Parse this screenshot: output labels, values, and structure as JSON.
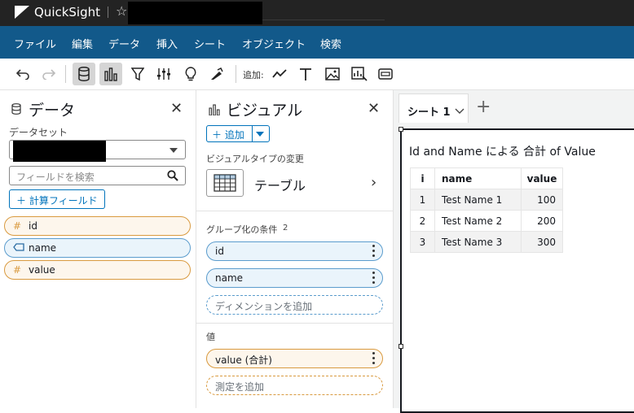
{
  "app": {
    "name": "QuickSight"
  },
  "menu": [
    "ファイル",
    "編集",
    "データ",
    "挿入",
    "シート",
    "オブジェクト",
    "検索"
  ],
  "toolbar": {
    "add_label": "追加:"
  },
  "data_panel": {
    "title": "データ",
    "dataset_label": "データセット",
    "search_placeholder": "フィールドを検索",
    "calc_field_label": "＋ 計算フィールド",
    "fields": [
      {
        "name": "id",
        "kind": "measure-number",
        "icon": "#"
      },
      {
        "name": "name",
        "kind": "dimension-text",
        "icon": "tag-icon"
      },
      {
        "name": "value",
        "kind": "measure-number",
        "icon": "#"
      }
    ]
  },
  "visual_panel": {
    "title": "ビジュアル",
    "add_label": "＋ 追加",
    "change_type_label": "ビジュアルタイプの変更",
    "type_name": "テーブル",
    "group_by_label": "グループ化の条件",
    "group_by_count": "2",
    "group_by_fields": [
      "id",
      "name"
    ],
    "add_dimension": "ディメンションを追加",
    "value_label": "値",
    "value_fields": [
      "value (合計)"
    ],
    "add_measure": "測定を追加"
  },
  "sheet": {
    "tab_label": "シート 1",
    "visual_title": "Id and Name による 合計 of Value",
    "table": {
      "headers": [
        "i",
        "name",
        "value"
      ],
      "rows": [
        [
          "1",
          "Test Name 1",
          "100"
        ],
        [
          "2",
          "Test Name 2",
          "200"
        ],
        [
          "3",
          "Test Name 3",
          "300"
        ]
      ]
    }
  },
  "colors": {
    "menubar": "#12598a",
    "accent": "#0073bb",
    "dimension": "#5b9ccd",
    "measure": "#d99a3f"
  }
}
